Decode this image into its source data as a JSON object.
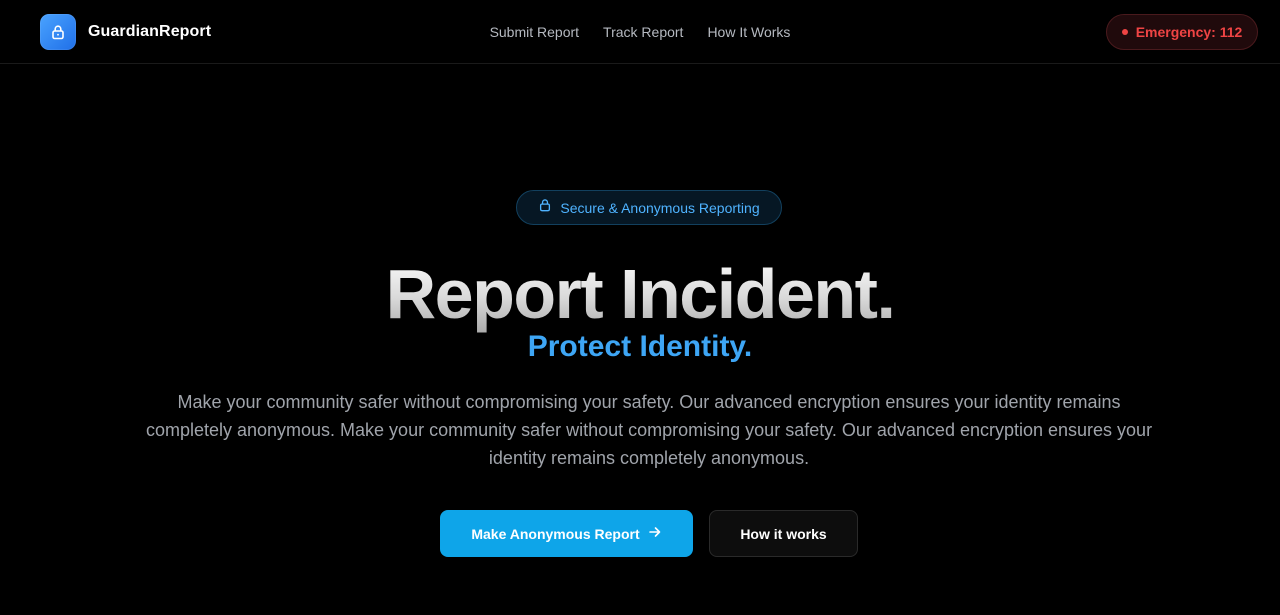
{
  "header": {
    "brand": "GuardianReport",
    "logo_icon": "lock-icon",
    "nav": [
      "Submit Report",
      "Track Report",
      "How It Works"
    ],
    "emergency_label": "Emergency: 112"
  },
  "hero": {
    "badge": "Secure & Anonymous Reporting",
    "badge_icon": "lock-icon",
    "title": "Report Incident.",
    "subtitle": "Protect Identity.",
    "description": "Make your community safer without compromising your safety. Our advanced encryption ensures your identity remains completely anonymous. Make your community safer without compromising your safety. Our advanced encryption ensures your identity remains completely anonymous.",
    "primary_button": "Make Anonymous Report",
    "primary_button_icon": "arrow-right-icon",
    "secondary_button": "How it works"
  },
  "colors": {
    "background": "#000000",
    "accent": "#0ea5e9",
    "subtitle": "#3ea6f5",
    "emergency": "#ef4444"
  }
}
